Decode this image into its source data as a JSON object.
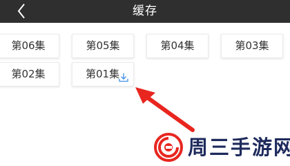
{
  "header": {
    "title": "缓存",
    "back_icon": "chevron-left-icon"
  },
  "episodes": [
    {
      "label": "第06集"
    },
    {
      "label": "第05集"
    },
    {
      "label": "第04集"
    },
    {
      "label": "第03集"
    },
    {
      "label": "第02集"
    },
    {
      "label": "第01集",
      "downloading": true,
      "icon": "download-icon"
    }
  ],
  "watermark": {
    "text": "周三手游网",
    "logo": "spiral-logo"
  },
  "colors": {
    "header_bg": "#2f2f2f",
    "arrow": "#e8261f",
    "download_icon": "#3d8de6"
  }
}
